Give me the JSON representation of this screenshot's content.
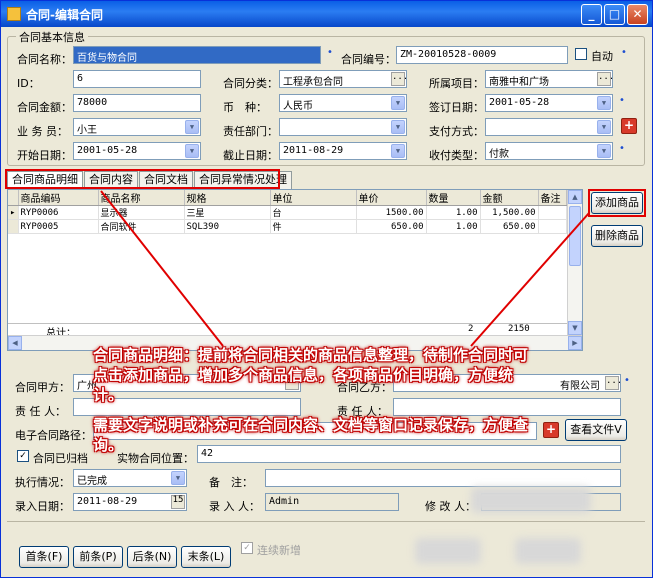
{
  "window": {
    "title": "合同-编辑合同",
    "minimize": "_",
    "maximize": "□",
    "close": "✕"
  },
  "basic": {
    "group_title": "合同基本信息",
    "name_label": "合同名称：",
    "name_value": "百货与物合同",
    "code_label": "合同编号：",
    "code_value": "ZM-20010528-0009",
    "auto_label": "自动",
    "id_label": "ID：",
    "id_value": "6",
    "category_label": "合同分类：",
    "category_value": "工程承包合同",
    "project_label": "所属项目：",
    "project_value": "南雅中和广场",
    "amount_label": "合同金额：",
    "amount_value": "78000",
    "currency_label": "币　种：",
    "currency_value": "人民币",
    "sign_date_label": "签订日期：",
    "sign_date_value": "2001-05-28",
    "salesman_label": "业 务 员：",
    "salesman_value": "小王",
    "dept_label": "责任部门：",
    "dept_value": "",
    "pay_method_label": "支付方式：",
    "pay_method_value": "",
    "start_date_label": "开始日期：",
    "start_date_value": "2001-05-28",
    "end_date_label": "截止日期：",
    "end_date_value": "2011-08-29",
    "income_type_label": "收付类型：",
    "income_type_value": "付款"
  },
  "tabs": [
    "合同商品明细",
    "合同内容",
    "合同文档",
    "合同异常情况处理"
  ],
  "grid": {
    "columns": [
      "商品编码",
      "商品名称",
      "规格",
      "单位",
      "单价",
      "数量",
      "金额",
      "备注"
    ],
    "rows": [
      [
        "RYP0006",
        "显示器",
        "三星",
        "台",
        "1500.00",
        "1.00",
        "1,500.00",
        ""
      ],
      [
        "RYP0005",
        "合同软件",
        "SQL390",
        "件",
        "650.00",
        "1.00",
        "650.00",
        ""
      ]
    ],
    "total_label": "总计：",
    "total_qty": "2",
    "total_amount": "2150"
  },
  "side_buttons": {
    "add": "添加商品",
    "delete": "删除商品"
  },
  "lower": {
    "party_a_label": "合同甲方：",
    "party_a_value": "广州",
    "party_b_label": "合同乙方：",
    "party_b_value": "有限公司",
    "resp_a_label": "责 任 人：",
    "resp_b_label": "责 任 人：",
    "e_path_label": "电子合同路径：",
    "view_file": "查看文件V",
    "archived_label": "合同已归档",
    "archive_pos_label": "实物合同位置：",
    "archive_pos_value": "42",
    "exec_label": "执行情况：",
    "exec_value": "已完成",
    "remark_label": "备　注：",
    "entry_date_label": "录入日期：",
    "entry_date_value": "2011-08-29",
    "entry_person_label": "录 入 人：",
    "entry_person_value": "Admin",
    "modify_person_label": "修 改 人："
  },
  "nav": {
    "first": "首条(F)",
    "prev": "前条(P)",
    "next": "后条(N)",
    "last": "末条(L)",
    "continuous": "连续新增"
  },
  "annotations": {
    "a1": "合同商品明细：提前将合同相关的商品信息整理，待制作合同时可点击添加商品，增加多个商品信息，各项商品价目明确，方便统计。",
    "a2": "需要文字说明或补充可在合同内容、文档等窗口记录保存，方便查询。"
  }
}
